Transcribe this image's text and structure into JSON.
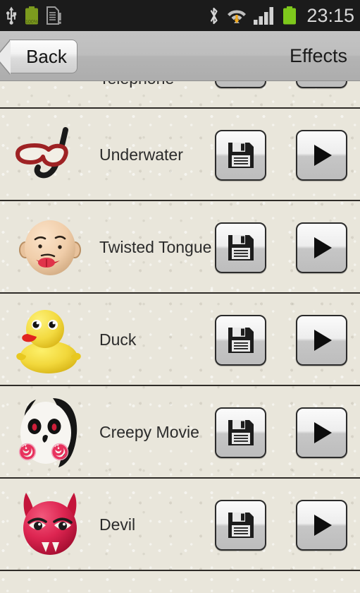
{
  "status_bar": {
    "time": "23:15",
    "battery_percent_label": "100%",
    "icons_left": [
      "usb-icon",
      "battery-charging-icon",
      "sd-card-warning-icon"
    ],
    "icons_right": [
      "bluetooth-icon",
      "wifi-download-icon",
      "signal-bars-icon",
      "battery-icon"
    ],
    "background_color": "#1b1b1b",
    "text_color": "#d8d8d8"
  },
  "header": {
    "back_label": "Back",
    "title": "Effects",
    "background_color": "#bdbdbd"
  },
  "list": {
    "background_color": "#e9e6db",
    "separator_color": "#2f2c28",
    "rows": [
      {
        "label": "Telephone",
        "icon": "telephone-handset-icon",
        "icon_color": "#e8742e",
        "save_label": "",
        "play_label": "",
        "partial": true
      },
      {
        "label": "Underwater",
        "icon": "diving-goggles-snorkel-icon",
        "icon_color": "#9e2224",
        "save_label": "",
        "play_label": "",
        "partial": false
      },
      {
        "label": "Twisted Tongue",
        "icon": "bald-face-tongue-icon",
        "icon_color": "#f2cfae",
        "save_label": "",
        "play_label": "",
        "partial": false
      },
      {
        "label": "Duck",
        "icon": "rubber-duck-icon",
        "icon_color": "#f2d83c",
        "save_label": "",
        "play_label": "",
        "partial": false
      },
      {
        "label": "Creepy Movie",
        "icon": "creepy-puppet-face-icon",
        "icon_color": "#f4f2ef",
        "save_label": "",
        "play_label": "",
        "partial": false
      },
      {
        "label": "Devil",
        "icon": "devil-face-icon",
        "icon_color": "#d81f45",
        "save_label": "",
        "play_label": "",
        "partial": false
      }
    ],
    "button_names": {
      "save": "save-icon",
      "play": "play-icon"
    }
  }
}
